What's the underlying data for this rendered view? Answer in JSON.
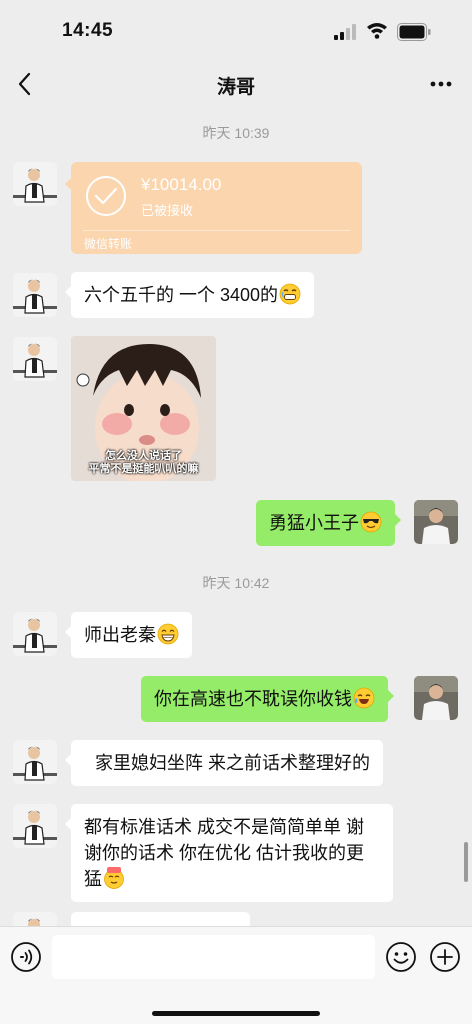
{
  "status_bar": {
    "time": "14:45"
  },
  "header": {
    "title": "涛哥"
  },
  "messages": {
    "ts1": "昨天 10:39",
    "transfer": {
      "amount": "¥10014.00",
      "status": "已被接收",
      "label": "微信转账"
    },
    "m1": "六个五千的 一个 3400的",
    "sticker": {
      "line1": "怎么没人说话了",
      "line2": "平常不是挺能叭叭的嘛"
    },
    "m2": "勇猛小王子",
    "ts2": "昨天 10:42",
    "m3": "师出老秦",
    "m4": "你在高速也不耽误你收钱",
    "m5": "家里媳妇坐阵 来之前话术整理好的",
    "m6_line1": "都有标准话术 成交不是简简单单 谢",
    "m6_line2": "谢你的话术 你在优化 估计我收的更",
    "m6_line3": "猛"
  },
  "colors": {
    "background": "#ededed",
    "incoming_bubble": "#ffffff",
    "outgoing_bubble": "#95ec69",
    "transfer_card": "#fbd5ad"
  }
}
